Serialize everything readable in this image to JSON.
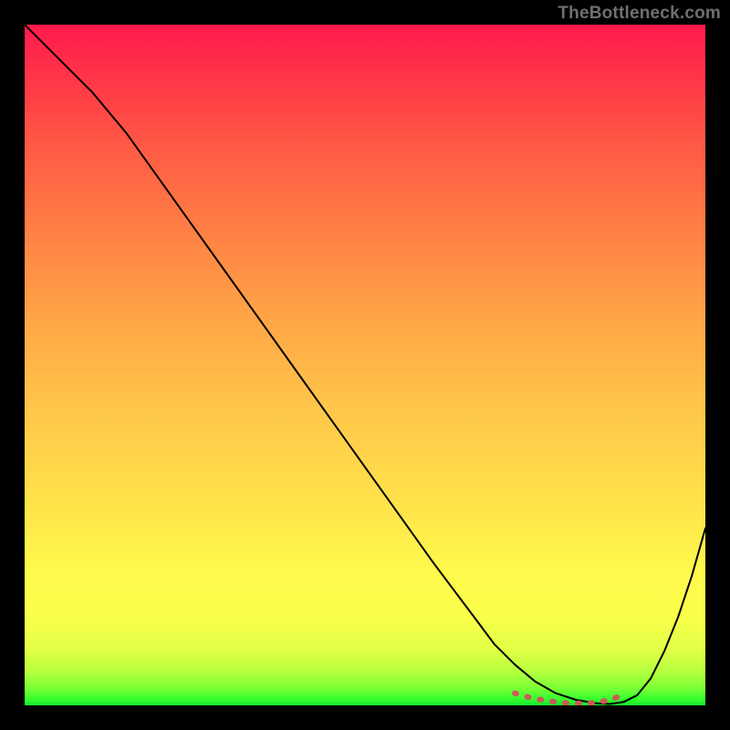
{
  "watermark": "TheBottleneck.com",
  "colors": {
    "black_border": "#000000",
    "curve": "#000000",
    "dotted_accent": "#cc5a57",
    "gradient_top": "#ff1a4d",
    "gradient_bottom": "#17e82b"
  },
  "chart_data": {
    "type": "line",
    "title": "",
    "xlabel": "",
    "ylabel": "",
    "xlim": [
      0,
      100
    ],
    "ylim": [
      0,
      100
    ],
    "grid": false,
    "legend_position": "none",
    "series": [
      {
        "name": "main-curve",
        "color": "#000000",
        "x": [
          0,
          3,
          6,
          10,
          15,
          20,
          25,
          30,
          35,
          40,
          45,
          50,
          55,
          60,
          63,
          66,
          69,
          72,
          75,
          78,
          81,
          84,
          86,
          88,
          90,
          92,
          94,
          96,
          98,
          100
        ],
        "values": [
          100,
          97,
          94,
          90,
          84,
          77,
          70,
          63,
          56,
          49,
          42,
          35,
          28,
          21,
          17,
          13,
          9,
          6,
          3.5,
          1.8,
          0.8,
          0.3,
          0.2,
          0.5,
          1.5,
          4,
          8,
          13,
          19,
          26
        ]
      },
      {
        "name": "optimal-range-dots",
        "color": "#cc5a57",
        "x": [
          72,
          74,
          76,
          78,
          80,
          82,
          84,
          86,
          88
        ],
        "values": [
          1.8,
          1.2,
          0.8,
          0.5,
          0.3,
          0.3,
          0.4,
          0.8,
          1.6
        ]
      }
    ],
    "annotations": []
  }
}
